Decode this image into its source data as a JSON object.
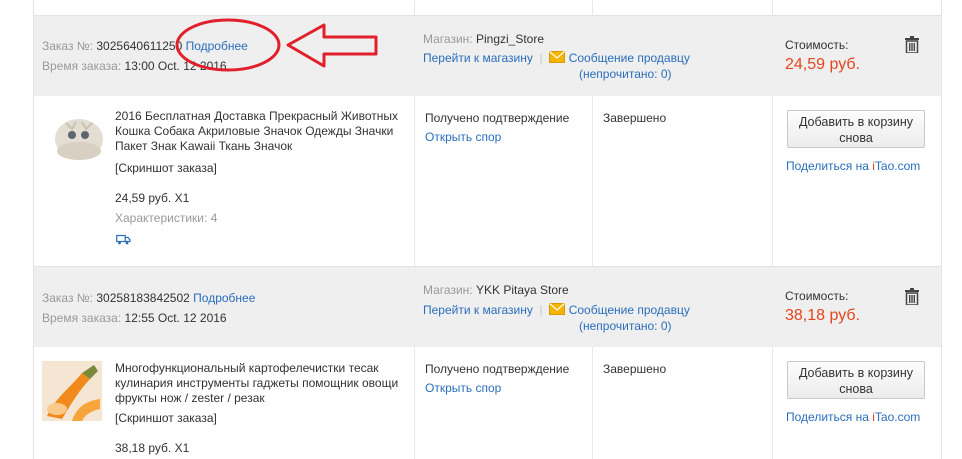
{
  "orders": [
    {
      "order_label": "Заказ №:",
      "order_number": "3025640611250",
      "details_link": "Подробнее",
      "time_label": "Время заказа:",
      "time_value": "13:00 Oct. 12 2016",
      "store_label": "Магазин:",
      "store_name": "Pingzi_Store",
      "goto_store": "Перейти к магазину",
      "message_seller": "Сообщение продавцу",
      "unread": "(непрочитано: 0)",
      "cost_label": "Стоимость:",
      "cost_value": "24,59 руб.",
      "item_title": "2016 Бесплатная Доставка Прекрасный Животных Кошка Собака Акриловые Значок Одежды Значки Пакет Знак Kawaii Ткань Значок",
      "snapshot": "[Скриншот заказа]",
      "price_qty": "24,59 руб. X1",
      "characteristics": "Характеристики: 4",
      "status_confirm": "Получено подтверждение",
      "open_dispute": "Открыть спор",
      "status": "Завершено",
      "add_cart": "Добавить в корзину снова",
      "share_text": "Поделиться на ",
      "share_brand_i": "i",
      "share_brand_rest": "Tao.com"
    },
    {
      "order_label": "Заказ №:",
      "order_number": "30258183842502",
      "details_link": "Подробнее",
      "time_label": "Время заказа:",
      "time_value": "12:55 Oct. 12 2016",
      "store_label": "Магазин:",
      "store_name": "YKK Pitaya Store",
      "goto_store": "Перейти к магазину",
      "message_seller": "Сообщение продавцу",
      "unread": "(непрочитано: 0)",
      "cost_label": "Стоимость:",
      "cost_value": "38,18 руб.",
      "item_title": "Многофункциональный картофелечистки тесак кулинария инструменты гаджеты помощник овощи фрукты нож / zester / резак",
      "snapshot": "[Скриншот заказа]",
      "price_qty": "38,18 руб. X1",
      "status_confirm": "Получено подтверждение",
      "open_dispute": "Открыть спор",
      "status": "Завершено",
      "add_cart": "Добавить в корзину снова",
      "share_text": "Поделиться на ",
      "share_brand_i": "i",
      "share_brand_rest": "Tao.com"
    }
  ],
  "colors": {
    "link": "#2a6ebb",
    "price": "#e6441c",
    "annotation": "#e0202a",
    "header_bg": "#efefef"
  }
}
